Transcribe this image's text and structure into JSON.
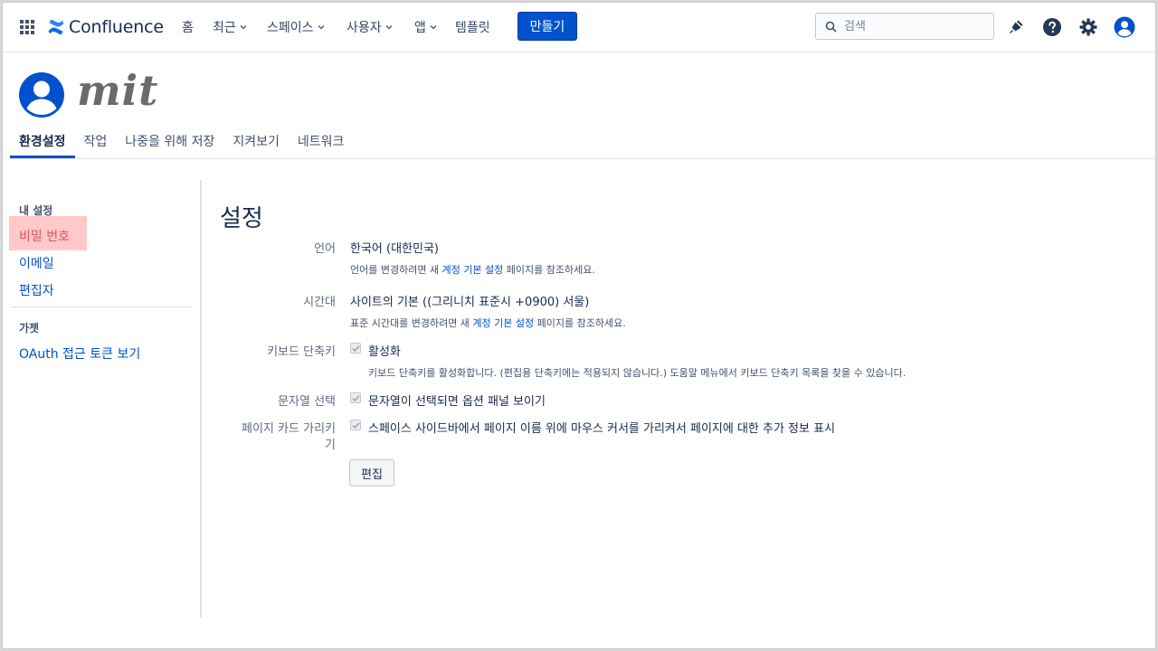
{
  "topnav": {
    "logo": "Confluence",
    "items": [
      {
        "label": "홈"
      },
      {
        "label": "최근"
      },
      {
        "label": "스페이스"
      },
      {
        "label": "사용자"
      },
      {
        "label": "앱"
      },
      {
        "label": "템플릿"
      }
    ],
    "create_label": "만들기",
    "search_placeholder": "검색"
  },
  "profile": {
    "name": "mit",
    "tabs": [
      "환경설정",
      "작업",
      "나중을 위해 저장",
      "지켜보기",
      "네트워크"
    ],
    "active_tab": "환경설정"
  },
  "sidebar": {
    "section1": "내 설정",
    "items": [
      "비밀 번호",
      "이메일",
      "편집자"
    ],
    "section2": "가젯",
    "items2": [
      "OAuth 접근 토큰 보기"
    ],
    "highlight_color": "#ffb7b7"
  },
  "settings": {
    "title": "설정",
    "language_label": "언어",
    "language_value": "한국어 (대한민국)",
    "language_help_pre": "언어를 변경하려면 새 ",
    "language_help_link": "계정 기본 설정",
    "language_help_post": " 페이지를 참조하세요.",
    "timezone_label": "시간대",
    "timezone_value": "사이트의 기본 ((그리니치 표준시 +0900) 서울)",
    "timezone_help_pre": "표준 시간대를 변경하려면 새 ",
    "timezone_help_link": "계정 기본 설정",
    "timezone_help_post": " 페이지를 참조하세요.",
    "shortcut_label": "키보드 단축키",
    "shortcut_value": "활성화",
    "shortcut_help": "키보드 단축키를 활성화합니다. (편집용 단축키에는 적용되지 않습니다.) 도움말 메뉴에서 키보드 단축키 목록을 찾을 수 있습니다.",
    "textsel_label": "문자열 선택",
    "textsel_value": "문자열이 선택되면 옵션 패널 보이기",
    "pagecard_label_1": "페이지 카드 가리키",
    "pagecard_label_2": "기",
    "pagecard_value": "스페이스 사이드바에서 페이지 이름 위에 마우스 커서를 가리켜서 페이지에 대한 추가 정보 표시",
    "edit_label": "편집"
  },
  "colors": {
    "accent": "#0052cc",
    "text": "#172b4d"
  }
}
